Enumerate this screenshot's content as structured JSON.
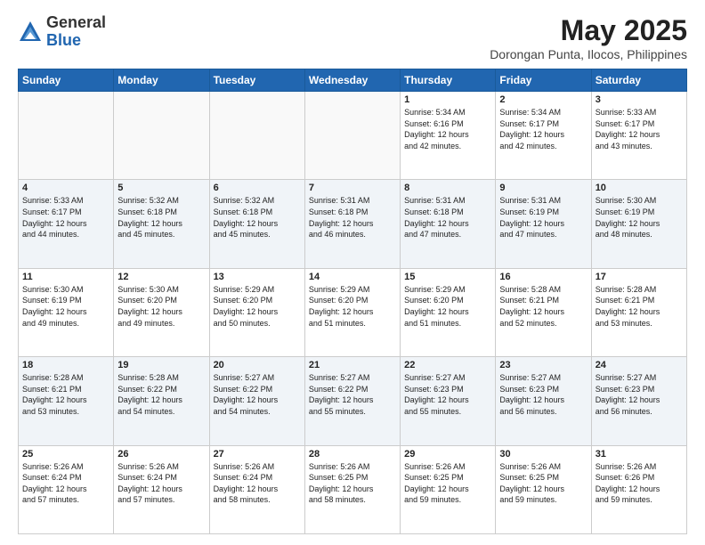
{
  "logo": {
    "general": "General",
    "blue": "Blue"
  },
  "title": "May 2025",
  "subtitle": "Dorongan Punta, Ilocos, Philippines",
  "days_header": [
    "Sunday",
    "Monday",
    "Tuesday",
    "Wednesday",
    "Thursday",
    "Friday",
    "Saturday"
  ],
  "weeks": [
    [
      {
        "num": "",
        "info": ""
      },
      {
        "num": "",
        "info": ""
      },
      {
        "num": "",
        "info": ""
      },
      {
        "num": "",
        "info": ""
      },
      {
        "num": "1",
        "info": "Sunrise: 5:34 AM\nSunset: 6:16 PM\nDaylight: 12 hours\nand 42 minutes."
      },
      {
        "num": "2",
        "info": "Sunrise: 5:34 AM\nSunset: 6:17 PM\nDaylight: 12 hours\nand 42 minutes."
      },
      {
        "num": "3",
        "info": "Sunrise: 5:33 AM\nSunset: 6:17 PM\nDaylight: 12 hours\nand 43 minutes."
      }
    ],
    [
      {
        "num": "4",
        "info": "Sunrise: 5:33 AM\nSunset: 6:17 PM\nDaylight: 12 hours\nand 44 minutes."
      },
      {
        "num": "5",
        "info": "Sunrise: 5:32 AM\nSunset: 6:18 PM\nDaylight: 12 hours\nand 45 minutes."
      },
      {
        "num": "6",
        "info": "Sunrise: 5:32 AM\nSunset: 6:18 PM\nDaylight: 12 hours\nand 45 minutes."
      },
      {
        "num": "7",
        "info": "Sunrise: 5:31 AM\nSunset: 6:18 PM\nDaylight: 12 hours\nand 46 minutes."
      },
      {
        "num": "8",
        "info": "Sunrise: 5:31 AM\nSunset: 6:18 PM\nDaylight: 12 hours\nand 47 minutes."
      },
      {
        "num": "9",
        "info": "Sunrise: 5:31 AM\nSunset: 6:19 PM\nDaylight: 12 hours\nand 47 minutes."
      },
      {
        "num": "10",
        "info": "Sunrise: 5:30 AM\nSunset: 6:19 PM\nDaylight: 12 hours\nand 48 minutes."
      }
    ],
    [
      {
        "num": "11",
        "info": "Sunrise: 5:30 AM\nSunset: 6:19 PM\nDaylight: 12 hours\nand 49 minutes."
      },
      {
        "num": "12",
        "info": "Sunrise: 5:30 AM\nSunset: 6:20 PM\nDaylight: 12 hours\nand 49 minutes."
      },
      {
        "num": "13",
        "info": "Sunrise: 5:29 AM\nSunset: 6:20 PM\nDaylight: 12 hours\nand 50 minutes."
      },
      {
        "num": "14",
        "info": "Sunrise: 5:29 AM\nSunset: 6:20 PM\nDaylight: 12 hours\nand 51 minutes."
      },
      {
        "num": "15",
        "info": "Sunrise: 5:29 AM\nSunset: 6:20 PM\nDaylight: 12 hours\nand 51 minutes."
      },
      {
        "num": "16",
        "info": "Sunrise: 5:28 AM\nSunset: 6:21 PM\nDaylight: 12 hours\nand 52 minutes."
      },
      {
        "num": "17",
        "info": "Sunrise: 5:28 AM\nSunset: 6:21 PM\nDaylight: 12 hours\nand 53 minutes."
      }
    ],
    [
      {
        "num": "18",
        "info": "Sunrise: 5:28 AM\nSunset: 6:21 PM\nDaylight: 12 hours\nand 53 minutes."
      },
      {
        "num": "19",
        "info": "Sunrise: 5:28 AM\nSunset: 6:22 PM\nDaylight: 12 hours\nand 54 minutes."
      },
      {
        "num": "20",
        "info": "Sunrise: 5:27 AM\nSunset: 6:22 PM\nDaylight: 12 hours\nand 54 minutes."
      },
      {
        "num": "21",
        "info": "Sunrise: 5:27 AM\nSunset: 6:22 PM\nDaylight: 12 hours\nand 55 minutes."
      },
      {
        "num": "22",
        "info": "Sunrise: 5:27 AM\nSunset: 6:23 PM\nDaylight: 12 hours\nand 55 minutes."
      },
      {
        "num": "23",
        "info": "Sunrise: 5:27 AM\nSunset: 6:23 PM\nDaylight: 12 hours\nand 56 minutes."
      },
      {
        "num": "24",
        "info": "Sunrise: 5:27 AM\nSunset: 6:23 PM\nDaylight: 12 hours\nand 56 minutes."
      }
    ],
    [
      {
        "num": "25",
        "info": "Sunrise: 5:26 AM\nSunset: 6:24 PM\nDaylight: 12 hours\nand 57 minutes."
      },
      {
        "num": "26",
        "info": "Sunrise: 5:26 AM\nSunset: 6:24 PM\nDaylight: 12 hours\nand 57 minutes."
      },
      {
        "num": "27",
        "info": "Sunrise: 5:26 AM\nSunset: 6:24 PM\nDaylight: 12 hours\nand 58 minutes."
      },
      {
        "num": "28",
        "info": "Sunrise: 5:26 AM\nSunset: 6:25 PM\nDaylight: 12 hours\nand 58 minutes."
      },
      {
        "num": "29",
        "info": "Sunrise: 5:26 AM\nSunset: 6:25 PM\nDaylight: 12 hours\nand 59 minutes."
      },
      {
        "num": "30",
        "info": "Sunrise: 5:26 AM\nSunset: 6:25 PM\nDaylight: 12 hours\nand 59 minutes."
      },
      {
        "num": "31",
        "info": "Sunrise: 5:26 AM\nSunset: 6:26 PM\nDaylight: 12 hours\nand 59 minutes."
      }
    ]
  ]
}
